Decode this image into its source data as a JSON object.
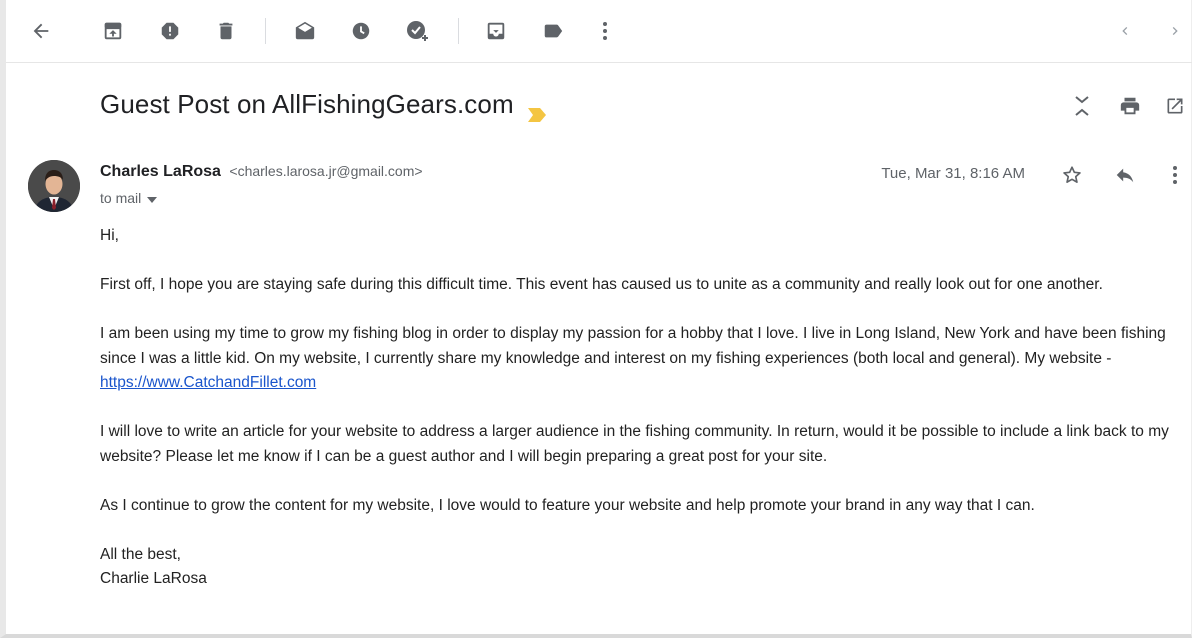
{
  "toolbar": {
    "icons": [
      "back-arrow-icon",
      "archive-icon",
      "report-spam-icon",
      "delete-icon",
      "mark-unread-icon",
      "snooze-icon",
      "add-to-tasks-icon",
      "move-to-icon",
      "labels-icon",
      "more-vert-icon",
      "prev-icon",
      "next-icon"
    ]
  },
  "subject": {
    "text": "Guest Post on AllFishingGears.com",
    "importance_color": "#f4c542"
  },
  "sender": {
    "name": "Charles LaRosa",
    "email": "<charles.larosa.jr@gmail.com>",
    "to": "to mail",
    "date": "Tue, Mar 31, 8:16 AM"
  },
  "body": {
    "greeting": "Hi,",
    "p1": "First off, I hope you are staying safe during this difficult time. This event has caused us to unite as a community and really look out for one another.",
    "p2_text": "I am been using my time to grow my fishing blog in order to display my passion for a hobby that I love. I live in Long Island, New York and have been fishing since I was a little kid. On my website, I currently share my knowledge and interest on my fishing experiences (both local and general). My website - ",
    "p2_link": "https://www.CatchandFillet.com",
    "p3": "I will love to write an article for your website to address a larger audience in the fishing community. In return, would it be possible to include a link back to my website? Please let me know if I can be a guest author and I will begin preparing a great post for your site.",
    "p4": "As I continue to grow the content for my website, I love would to feature your website and help promote your brand in any way that I can.",
    "signoff": "All the best,",
    "signature": "Charlie LaRosa"
  },
  "colors": {
    "icon": "#5f6368",
    "link": "#1a55cc",
    "text": "#222222"
  }
}
